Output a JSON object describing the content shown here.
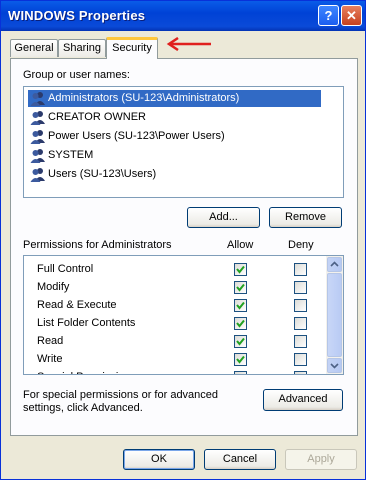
{
  "window": {
    "title": "WINDOWS Properties",
    "help_label": "?",
    "close_label": "✕"
  },
  "tabs": [
    {
      "label": "General"
    },
    {
      "label": "Sharing"
    },
    {
      "label": "Security"
    }
  ],
  "annotation": {
    "arrow_color": "#e0201e"
  },
  "groups": {
    "label": "Group or user names:",
    "items": [
      {
        "label": "Administrators (SU-123\\Administrators)",
        "selected": true
      },
      {
        "label": "CREATOR OWNER"
      },
      {
        "label": "Power Users (SU-123\\Power Users)"
      },
      {
        "label": "SYSTEM"
      },
      {
        "label": "Users (SU-123\\Users)"
      }
    ],
    "add_label": "Add...",
    "remove_label": "Remove"
  },
  "permissions": {
    "label": "Permissions for Administrators",
    "allow_header": "Allow",
    "deny_header": "Deny",
    "rows": [
      {
        "name": "Full Control",
        "allow": true,
        "deny": false
      },
      {
        "name": "Modify",
        "allow": true,
        "deny": false
      },
      {
        "name": "Read & Execute",
        "allow": true,
        "deny": false
      },
      {
        "name": "List Folder Contents",
        "allow": true,
        "deny": false
      },
      {
        "name": "Read",
        "allow": true,
        "deny": false
      },
      {
        "name": "Write",
        "allow": true,
        "deny": false
      },
      {
        "name": "Special Permissions",
        "allow": false,
        "deny": false
      }
    ]
  },
  "advanced": {
    "text": "For special permissions or for advanced settings, click Advanced.",
    "button_label": "Advanced"
  },
  "footer": {
    "ok_label": "OK",
    "cancel_label": "Cancel",
    "apply_label": "Apply"
  }
}
